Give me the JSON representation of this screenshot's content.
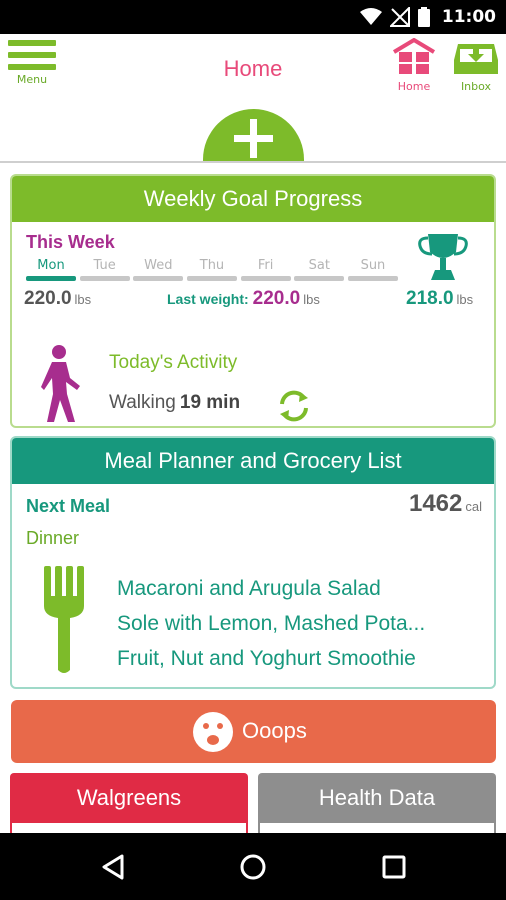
{
  "status_bar": {
    "time": "11:00",
    "icons": [
      "wifi-icon",
      "no-signal-icon",
      "battery-icon"
    ]
  },
  "app_bar": {
    "menu_label": "Menu",
    "title": "Home",
    "home_label": "Home",
    "inbox_label": "Inbox",
    "add_icon": "plus-icon"
  },
  "weekly_goal": {
    "title": "Weekly Goal Progress",
    "this_week_label": "This Week",
    "days": [
      {
        "label": "Mon",
        "active": true
      },
      {
        "label": "Tue",
        "active": false
      },
      {
        "label": "Wed",
        "active": false
      },
      {
        "label": "Thu",
        "active": false
      },
      {
        "label": "Fri",
        "active": false
      },
      {
        "label": "Sat",
        "active": false
      },
      {
        "label": "Sun",
        "active": false
      }
    ],
    "start_weight": "220.0",
    "start_unit": "lbs",
    "last_weight_label": "Last weight:",
    "last_weight": "220.0",
    "last_unit": "lbs",
    "goal_weight": "218.0",
    "goal_unit": "lbs",
    "activity_title": "Today's Activity",
    "activity_name": "Walking",
    "activity_duration": "19 min"
  },
  "meal_planner": {
    "title": "Meal Planner and Grocery List",
    "next_meal_label": "Next Meal",
    "calories": "1462",
    "calories_unit": "cal",
    "meal_type": "Dinner",
    "items": [
      "Macaroni and Arugula Salad",
      "Sole with Lemon, Mashed Pota...",
      "Fruit, Nut and Yoghurt Smoothie"
    ]
  },
  "ooops": {
    "label": "Ooops"
  },
  "tiles": {
    "walgreens": "Walgreens",
    "health_data": "Health Data"
  },
  "colors": {
    "green": "#7dbb2a",
    "teal": "#17987d",
    "pink": "#e84a7a",
    "purple": "#a72d8e",
    "orange": "#e8694a",
    "red": "#e02b45",
    "gray": "#8e8e8e"
  }
}
